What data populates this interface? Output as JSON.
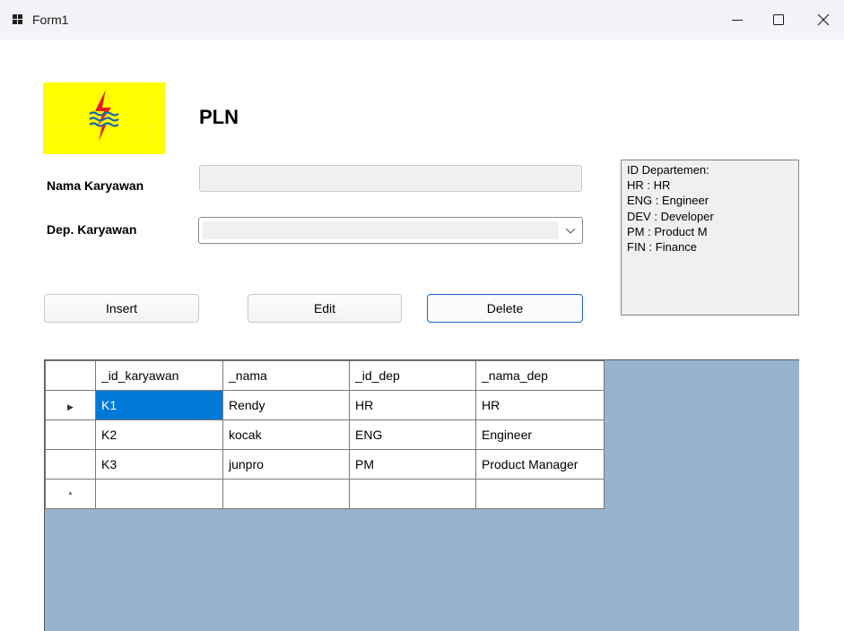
{
  "window": {
    "title": "Form1",
    "minimize_glyph": "—",
    "maximize_glyph": "☐",
    "close_glyph": "✕"
  },
  "header": {
    "logo_icon": "pln-lightning-logo-icon",
    "title": "PLN"
  },
  "form": {
    "nama_label": "Nama Karyawan",
    "nama_value": "",
    "dep_label": "Dep. Karyawan",
    "dep_value": ""
  },
  "buttons": {
    "insert": "Insert",
    "edit": "Edit",
    "delete": "Delete"
  },
  "info_box": {
    "lines": [
      "ID Departemen:",
      "HR : HR",
      "ENG : Engineer",
      "DEV : Developer",
      "PM : Product M",
      "FIN : Finance"
    ]
  },
  "grid": {
    "columns": [
      "_id_karyawan",
      "_nama",
      "_id_dep",
      "_nama_dep"
    ],
    "rows": [
      {
        "indicator": "▶",
        "cells": [
          "K1",
          "Rendy",
          "HR",
          "HR"
        ]
      },
      {
        "indicator": "",
        "cells": [
          "K2",
          "kocak",
          "ENG",
          "Engineer"
        ]
      },
      {
        "indicator": "",
        "cells": [
          "K3",
          "junpro",
          "PM",
          "Product Manager"
        ]
      }
    ],
    "new_row_indicator": "*",
    "selection_color": "#0078d7",
    "background_color": "#97b3ce"
  }
}
